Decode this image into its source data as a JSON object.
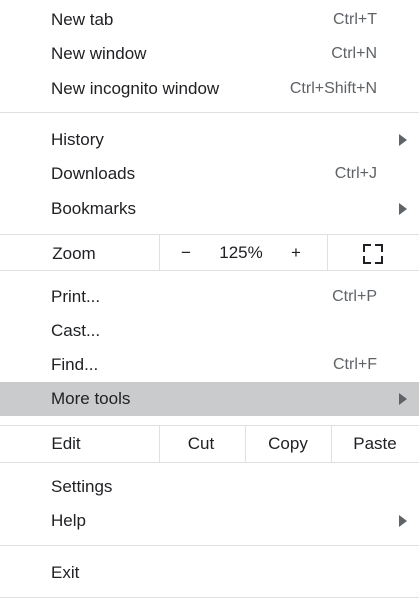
{
  "menu": {
    "new_tab": {
      "label": "New tab",
      "shortcut": "Ctrl+T"
    },
    "new_window": {
      "label": "New window",
      "shortcut": "Ctrl+N"
    },
    "new_incognito": {
      "label": "New incognito window",
      "shortcut": "Ctrl+Shift+N"
    },
    "history": {
      "label": "History"
    },
    "downloads": {
      "label": "Downloads",
      "shortcut": "Ctrl+J"
    },
    "bookmarks": {
      "label": "Bookmarks"
    },
    "zoom": {
      "label": "Zoom",
      "minus": "−",
      "level": "125%",
      "plus": "+",
      "fullscreen_icon": "fullscreen-icon"
    },
    "print": {
      "label": "Print...",
      "shortcut": "Ctrl+P"
    },
    "cast": {
      "label": "Cast..."
    },
    "find": {
      "label": "Find...",
      "shortcut": "Ctrl+F"
    },
    "more_tools": {
      "label": "More tools"
    },
    "edit": {
      "label": "Edit",
      "cut": "Cut",
      "copy": "Copy",
      "paste": "Paste"
    },
    "settings": {
      "label": "Settings"
    },
    "help": {
      "label": "Help"
    },
    "exit": {
      "label": "Exit"
    }
  },
  "colors": {
    "text": "#202124",
    "shortcut": "#5f6368",
    "highlight": "#cacbcc",
    "separator": "#e0e0e0"
  }
}
